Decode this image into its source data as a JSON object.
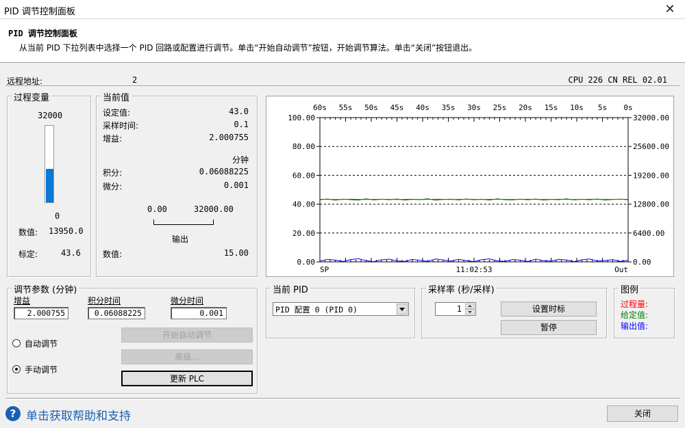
{
  "window": {
    "title": "PID 调节控制面板",
    "close_glyph": "✕"
  },
  "header": {
    "title": "PID 调节控制面板",
    "description": "从当前 PID 下拉列表中选择一个 PID 回路或配置进行调节。单击“开始自动调节”按钮，开始调节算法。单击“关闭”按钮退出。"
  },
  "info": {
    "remote_label": "远程地址:",
    "remote_value": "2",
    "cpu": "CPU 226 CN REL 02.01"
  },
  "process_variable": {
    "label": "过程变量",
    "max": "32000",
    "min": "0",
    "level_fraction": 0.436,
    "value_label": "数值:",
    "value": "13950.0",
    "scaled_label": "标定:",
    "scaled": "43.6"
  },
  "current_values": {
    "label": "当前值",
    "setpoint_label": "设定值:",
    "setpoint": "43.0",
    "sample_label": "采样时间:",
    "sample": "0.1",
    "gain_label": "增益:",
    "gain": "2.000755",
    "unit": "分钟",
    "integral_label": "积分:",
    "integral": "0.06088225",
    "derivative_label": "微分:",
    "derivative": "0.001",
    "output_min": "0.00",
    "output_max": "32000.00",
    "output_label": "输出",
    "output_value_label": "数值:",
    "output_value": "15.00"
  },
  "chart_data": {
    "type": "line",
    "x_tick_labels": [
      "60s",
      "55s",
      "50s",
      "45s",
      "40s",
      "35s",
      "30s",
      "25s",
      "20s",
      "15s",
      "10s",
      "5s",
      "0s"
    ],
    "y_left_ticks": [
      "100.00",
      "80.00",
      "60.00",
      "40.00",
      "20.00",
      "0.00"
    ],
    "y_right_ticks": [
      "32000.00",
      "25600.00",
      "19200.00",
      "12800.00",
      "6400.00",
      "0.00"
    ],
    "ylim_left": [
      0,
      100
    ],
    "ylim_right": [
      0,
      32000
    ],
    "bottom_left_label": "SP",
    "bottom_center_label": "11:02:53",
    "bottom_right_label": "Out",
    "grid": "dashed horizontal",
    "series": [
      {
        "legend_ref": "过程量",
        "color": "#ff0000",
        "values": [
          43.4,
          43.3,
          43.2,
          43.3,
          43.4,
          43.3,
          43.2,
          43.3,
          43.4,
          43.3,
          43.2,
          43.3,
          43.4,
          43.2,
          43.3,
          43.4,
          43.3,
          43.2,
          43.3,
          43.4,
          43.3,
          43.2,
          43.3,
          43.4,
          43.3,
          43.2,
          43.3,
          43.4,
          43.3,
          43.2,
          43.3,
          43.4,
          43.3,
          43.2,
          43.3,
          43.4,
          43.3,
          43.2,
          43.3,
          43.4,
          43.3
        ]
      },
      {
        "legend_ref": "给定值",
        "color": "#008000",
        "values": [
          43.0,
          43.6,
          42.7,
          43.5,
          43.1,
          42.8,
          43.7,
          42.9,
          43.4,
          43.0,
          43.6,
          42.8,
          43.3,
          43.1,
          43.8,
          42.7,
          43.2,
          43.5,
          42.9,
          43.6,
          43.0,
          43.4,
          42.8,
          43.7,
          43.1,
          42.9,
          43.5,
          43.0,
          43.6,
          42.8,
          43.3,
          43.1,
          43.7,
          42.9,
          43.4,
          43.0,
          43.6,
          42.8,
          43.2,
          43.5,
          43.0
        ]
      },
      {
        "legend_ref": "输出值",
        "color": "#0000ff",
        "values": [
          0.5,
          1.8,
          1.2,
          0.3,
          1.6,
          2.2,
          0.8,
          0.2,
          1.4,
          1.9,
          0.6,
          0.4,
          1.7,
          1.1,
          0.3,
          2.0,
          1.3,
          0.5,
          1.8,
          0.9,
          0.2,
          1.5,
          2.1,
          0.7,
          0.4,
          1.6,
          1.2,
          0.3,
          1.9,
          0.8,
          0.5,
          1.7,
          1.3,
          0.2,
          1.4,
          2.0,
          0.6,
          0.9,
          1.5,
          0.4,
          1.1
        ]
      }
    ]
  },
  "tuning_params": {
    "label": "调节参数 (分钟)",
    "gain_label": "增益",
    "gain": "2.000755",
    "integral_label": "积分时间",
    "integral": "0.06088225",
    "derivative_label": "微分时间",
    "derivative": "0.001",
    "auto_radio": "自动调节",
    "manual_radio": "手动调节",
    "start_autotune": "开始自动调节",
    "advanced": "高级...",
    "update_plc": "更新 PLC"
  },
  "current_pid": {
    "label": "当前 PID",
    "selected": "PID 配置 0 (PID 0)"
  },
  "sample_rate": {
    "label": "采样率 (秒/采样)",
    "value": "1",
    "set_time_scale": "设置时标",
    "pause": "暂停"
  },
  "legend": {
    "label": "图例",
    "items": [
      {
        "text": "过程量:",
        "color": "#ff0000"
      },
      {
        "text": "给定值:",
        "color": "#008000"
      },
      {
        "text": "输出值:",
        "color": "#0000ff"
      }
    ]
  },
  "footer": {
    "help": "单击获取帮助和支持",
    "help_icon": "?",
    "close": "关闭"
  }
}
